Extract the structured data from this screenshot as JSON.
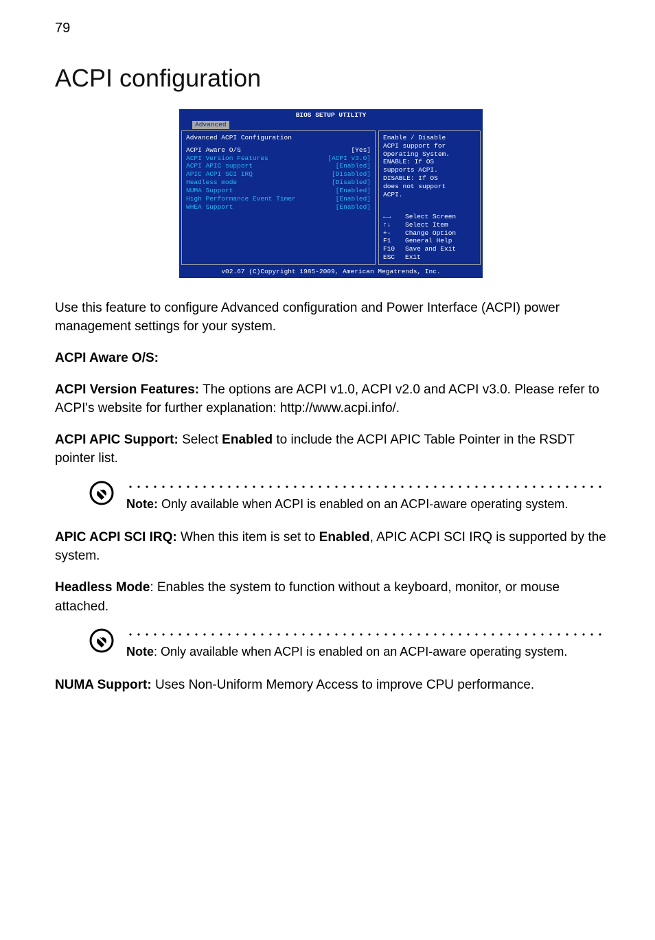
{
  "page_number": "79",
  "title": "ACPI configuration",
  "bios": {
    "window_title": "BIOS SETUP UTILITY",
    "tab": "Advanced",
    "subtitle": "Advanced ACPI Configuration",
    "rows": [
      {
        "label": "ACPI Aware O/S",
        "value": "[Yes]",
        "highlight": true
      },
      {
        "label": "ACPI Version Features",
        "value": "[ACPI v3.0]"
      },
      {
        "label": "ACPI APIC support",
        "value": "[Enabled]"
      },
      {
        "label": "APIC ACPI SCI IRQ",
        "value": "[Disabled]"
      },
      {
        "label": "Headless mode",
        "value": "[Disabled]"
      },
      {
        "label": "NUMA Support",
        "value": "[Enabled]"
      },
      {
        "label": "",
        "value": ""
      },
      {
        "label": "High Performance Event Timer",
        "value": "[Enabled]"
      },
      {
        "label": "WHEA Support",
        "value": "[Enabled]"
      }
    ],
    "help": {
      "lines": [
        "Enable / Disable",
        "ACPI support for",
        "Operating System.",
        "",
        "ENABLE: If OS",
        "supports ACPI.",
        "",
        "DISABLE: If OS",
        "does not support",
        "ACPI."
      ],
      "legend": [
        {
          "key": "←→",
          "text": "Select Screen"
        },
        {
          "key": "↑↓",
          "text": "Select Item"
        },
        {
          "key": "+-",
          "text": "Change Option"
        },
        {
          "key": "F1",
          "text": "General Help"
        },
        {
          "key": "F10",
          "text": "Save and Exit"
        },
        {
          "key": "ESC",
          "text": "Exit"
        }
      ]
    },
    "footer": "v02.67 (C)Copyright 1985-2009, American Megatrends, Inc."
  },
  "intro": "Use this feature to configure Advanced configuration and Power Interface (ACPI) power management settings for your system.",
  "sections": {
    "aware_label": "ACPI Aware O/S:",
    "version_label": "ACPI Version Features:",
    "version_text": " The options are ACPI v1.0, ACPI v2.0 and ACPI v3.0. Please refer to ACPI's website for further explanation: http://www.acpi.info/.",
    "apic_label": "ACPI APIC Support:",
    "apic_mid": " Select ",
    "apic_enabled": "Enabled",
    "apic_text": " to include the ACPI APIC Table Pointer in the RSDT pointer list.",
    "note1_label": "Note:",
    "note1_text": " Only available when ACPI is enabled on an ACPI-aware operating system.",
    "sci_label": "APIC ACPI SCI IRQ:",
    "sci_mid": " When this item is set to ",
    "sci_enabled": "Enabled",
    "sci_text": ", APIC ACPI SCI IRQ is supported by the system.",
    "headless_label": "Headless Mode",
    "headless_text": ": Enables the system to function without a keyboard, monitor, or mouse attached.",
    "note2_label": "Note",
    "note2_text": ": Only available when ACPI is enabled on an ACPI-aware operating system.",
    "numa_label": "NUMA Support:",
    "numa_text": " Uses Non-Uniform Memory Access to improve CPU performance."
  }
}
